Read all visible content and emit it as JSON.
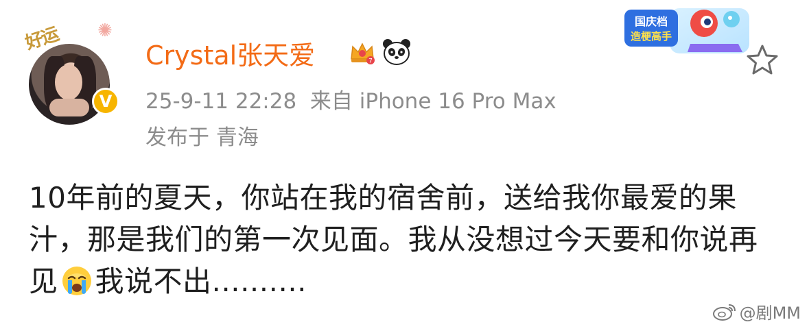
{
  "profile": {
    "username": "Crystal张天爱",
    "avatar_deco_text": "好运",
    "verified_mark": "V"
  },
  "post": {
    "timestamp": "25-9-11 22:28",
    "source": "来自 iPhone 16 Pro Max",
    "location": "发布于 青海",
    "text_part1": "10年前的夏天，你站在我的宿舍前，送给我你最爱的果汁，那是我们的第一次见面。我从没想过今天要和你说再见",
    "text_part2": "我说不出.........."
  },
  "badge": {
    "line1": "国庆档",
    "line2": "造梗高手"
  },
  "watermark": {
    "text": "@剧MM"
  },
  "colors": {
    "username": "#f36b16",
    "meta": "#8c8c8c",
    "verified": "#f7b500"
  },
  "icons": [
    "vip-crown-icon",
    "panda-icon",
    "star-icon",
    "crying-emoji-icon",
    "weibo-logo-icon"
  ]
}
